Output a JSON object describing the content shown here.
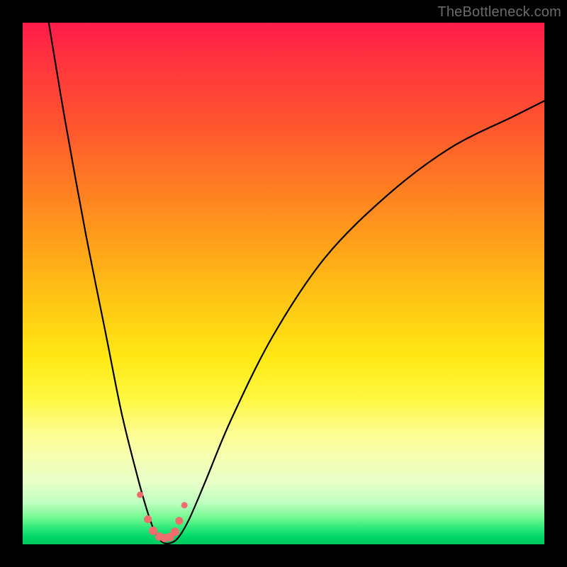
{
  "watermark": "TheBottleneck.com",
  "colors": {
    "background": "#000000",
    "gradient_top": "#ff1a4a",
    "gradient_bottom": "#00c860",
    "curve": "#000000",
    "marker": "#f06d6d"
  },
  "chart_data": {
    "type": "line",
    "title": "",
    "xlabel": "",
    "ylabel": "",
    "xlim": [
      0,
      100
    ],
    "ylim": [
      0,
      100
    ],
    "series": [
      {
        "name": "bottleneck-curve",
        "x": [
          5,
          8,
          12,
          16,
          19,
          22,
          24,
          25.5,
          27,
          28.5,
          30,
          32,
          35,
          40,
          48,
          58,
          70,
          82,
          94,
          100
        ],
        "values": [
          100,
          82,
          60,
          40,
          25,
          13,
          6,
          2,
          0.3,
          0.3,
          1.5,
          5,
          12,
          24,
          40,
          55,
          67,
          76,
          82,
          85
        ]
      }
    ],
    "markers": {
      "name": "valley-markers",
      "x": [
        22.5,
        24.0,
        25.0,
        26.2,
        27.2,
        28.2,
        29.2,
        30.0,
        31.0
      ],
      "values": [
        9.5,
        4.8,
        2.6,
        1.5,
        1.2,
        1.4,
        2.4,
        4.5,
        7.5
      ],
      "radius": [
        4.5,
        5.5,
        6.0,
        6.0,
        6.0,
        6.0,
        6.0,
        5.5,
        4.5
      ]
    }
  }
}
